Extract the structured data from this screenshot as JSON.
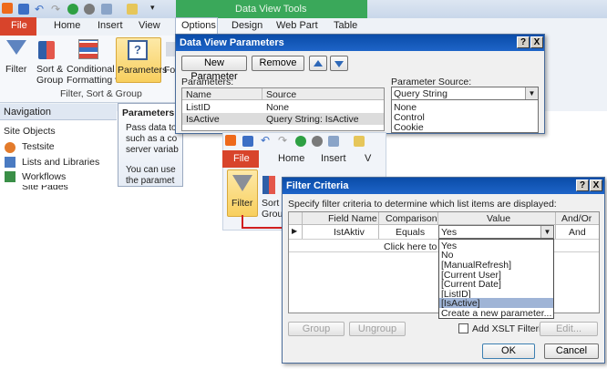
{
  "back_window": {
    "quick_access": [
      "save-icon",
      "undo-icon",
      "redo-icon",
      "refresh-icon",
      "preview-icon",
      "dropdown-icon"
    ],
    "contextual_title": "Data View Tools",
    "tabs": [
      "File",
      "Home",
      "Insert",
      "View",
      "Options",
      "Design",
      "Web Part",
      "Table"
    ],
    "ribbon_buttons": [
      {
        "label": "Filter",
        "icon": "filter-icon"
      },
      {
        "label": "Sort &\nGroup",
        "icon": "sort-group-icon"
      },
      {
        "label": "Conditional\nFormatting",
        "icon": "conditional-formatting-icon"
      },
      {
        "label": "Parameters",
        "icon": "parameters-icon"
      },
      {
        "label": "Fo",
        "icon": "formula-icon"
      }
    ],
    "group_label": "Filter, Sort & Group",
    "navigation": {
      "title": "Navigation",
      "section": "Site Objects",
      "items": [
        "Testsite",
        "Lists and Libraries",
        "Workflows",
        "Site Pages"
      ]
    },
    "tooltip": {
      "title": "Parameters",
      "lines": [
        "Pass data to",
        "such as a co",
        "server variab",
        "",
        "You can use",
        "the paramet"
      ]
    }
  },
  "params_dialog": {
    "title": "Data View Parameters",
    "help": "?",
    "close": "X",
    "new_button": "New Parameter",
    "remove_button": "Remove",
    "parameters_label": "Parameters:",
    "columns": [
      "Name",
      "Source"
    ],
    "rows": [
      {
        "name": "ListID",
        "source": "None"
      },
      {
        "name": "IsActive",
        "source": "Query String: IsActive"
      }
    ],
    "source_label": "Parameter Source:",
    "source_value": "Query String",
    "source_options": [
      "None",
      "Control",
      "Cookie"
    ]
  },
  "mini_ribbon": {
    "tabs": [
      "File",
      "Home",
      "Insert",
      "V"
    ],
    "buttons": [
      {
        "label": "Filter",
        "icon": "filter-icon"
      },
      {
        "label": "Sort\nGrou",
        "icon": "sort-icon"
      }
    ]
  },
  "filter_dialog": {
    "title": "Filter Criteria",
    "help": "?",
    "close": "X",
    "instruction": "Specify filter criteria to determine which list items are displayed:",
    "columns": [
      "Field Name",
      "Comparison",
      "Value",
      "And/Or"
    ],
    "row": {
      "arrow": "▶",
      "field": "IstAktiv",
      "comparison": "Equals",
      "value": "Yes",
      "andor": "And"
    },
    "add_row": "Click here to ad",
    "dropdown_options": [
      "Yes",
      "No",
      "[ManualRefresh]",
      "[Current User]",
      "[Current Date]",
      "[ListID]",
      "[IsActive]",
      "Create a new parameter..."
    ],
    "selected_option": "[IsActive]",
    "group_button": "Group",
    "ungroup_button": "Ungroup",
    "xslt_label": "Add XSLT Filtering",
    "edit_button": "Edit...",
    "ok_button": "OK",
    "cancel_button": "Cancel"
  },
  "colors": {
    "file_tab": "#d8442b",
    "dialog_title": "#0a4ca8",
    "highlight": "#fcd97a",
    "selection": "#9fb4d6",
    "arrow": "#d01f1f"
  }
}
